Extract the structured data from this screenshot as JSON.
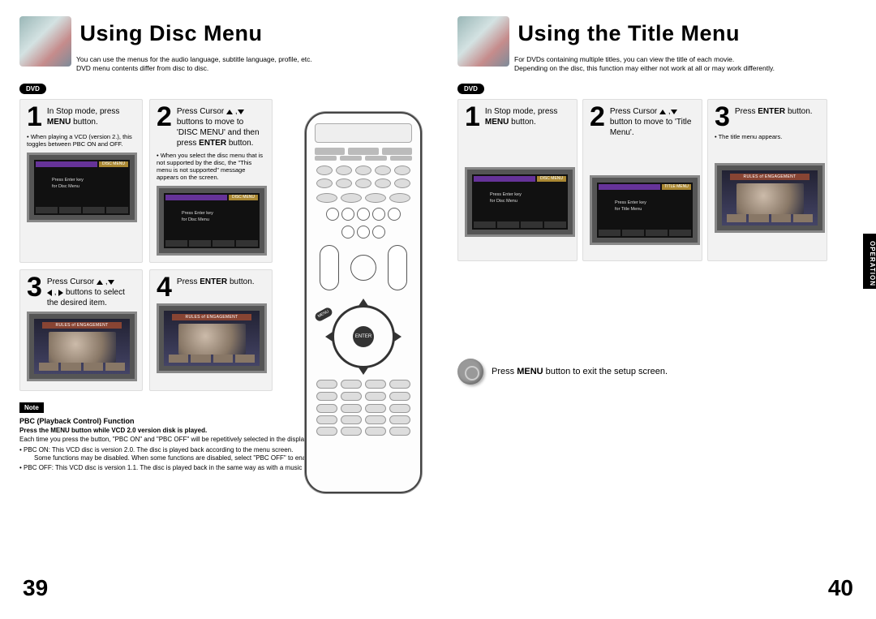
{
  "left": {
    "title": "Using Disc Menu",
    "intro1": "You can use the menus for the audio language, subtitle language, profile, etc.",
    "intro2": "DVD menu contents differ from disc to disc.",
    "badge": "DVD",
    "steps": [
      {
        "num": "1",
        "text_pre": "In Stop mode, press ",
        "text_bold": "MENU",
        "text_post": " button.",
        "bullet": "When playing a VCD (version 2.), this toggles between PBC ON and OFF.",
        "tv_label": "DISC MENU",
        "tv_txt": "Press Enter key\nfor Disc Menu"
      },
      {
        "num": "2",
        "text_pre": "Press Cursor ",
        "arrows": "ud",
        "text_mid": " buttons to move to 'DISC MENU' and then press ",
        "text_bold": "ENTER",
        "text_post": " button.",
        "bullet": "When you select the disc menu that is not supported by the disc, the \"This menu is not supported\" message appears on the screen.",
        "tv_label": "DISC MENU",
        "tv_txt": "Press Enter key\nfor Disc Menu"
      },
      {
        "num": "3",
        "text_pre": "Press Cursor ",
        "arrows": "udlr",
        "text_mid": " buttons to select the desired item.",
        "movie": true,
        "movie_title": "RULES of ENGAGEMENT"
      },
      {
        "num": "4",
        "text_pre": "Press ",
        "text_bold": "ENTER",
        "text_post": " button.",
        "movie": true,
        "movie_title": "RULES of ENGAGEMENT"
      }
    ],
    "note_tag": "Note",
    "note_title": "PBC (Playback Control) Function",
    "note_sub": "Press the MENU button while VCD 2.0 version disk is played.",
    "note_line1": "Each time you press the button, \"PBC ON\" and \"PBC OFF\" will be repetitively selected in the display.",
    "note_pbc_on": "PBC ON: This VCD disc is version 2.0. The disc is played back according to the menu screen.",
    "note_pbc_on_sub": "Some functions may be disabled. When some functions are disabled, select \"PBC OFF\" to enable them.",
    "note_pbc_off": "PBC OFF: This VCD disc is version 1.1. The disc is played back in the same way as with a music CD.",
    "page_num": "39"
  },
  "right": {
    "title": "Using the Title Menu",
    "intro1": "For DVDs containing multiple titles, you can view the title of each movie.",
    "intro2": "Depending on the disc, this function may either not work at all or may work differently.",
    "badge": "DVD",
    "side_tab": "OPERATION",
    "steps": [
      {
        "num": "1",
        "text_pre": "In Stop mode, press ",
        "text_bold": "MENU",
        "text_post": " button.",
        "tv_label": "DISC MENU",
        "tv_txt": "Press Enter key\nfor Disc Menu"
      },
      {
        "num": "2",
        "text_pre": "Press Cursor ",
        "arrows": "ud",
        "text_mid": " button to move to 'Title Menu'.",
        "tv_label": "TITLE MENU",
        "tv_txt": "Press Enter key\nfor Title Menu"
      },
      {
        "num": "3",
        "text_pre": "Press ",
        "text_bold": "ENTER",
        "text_post": " button.",
        "bullet": "The title menu appears.",
        "movie": true,
        "movie_title": "RULES of ENGAGEMENT"
      }
    ],
    "tip_pre": "Press ",
    "tip_bold": "MENU",
    "tip_post": " button to exit the setup screen.",
    "page_num": "40"
  },
  "remote": {
    "enter": "ENTER",
    "menu": "MENU"
  }
}
